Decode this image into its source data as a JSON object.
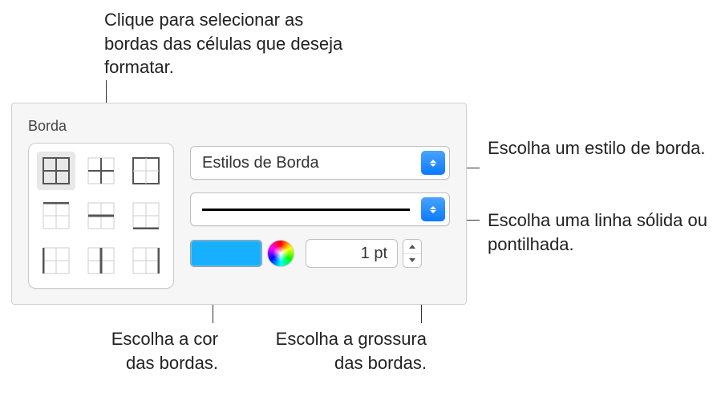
{
  "callouts": {
    "top": "Clique para selecionar as bordas das células que deseja formatar.",
    "right1": "Escolha um estilo de borda.",
    "right2": "Escolha uma linha sólida ou pontilhada.",
    "bottomLeft": "Escolha a cor das bordas.",
    "bottomRight": "Escolha a grossura das bordas."
  },
  "panel": {
    "title": "Borda",
    "borderButtons": [
      "all",
      "inside",
      "outside",
      "horizontal",
      "center-h",
      "vertical",
      "left",
      "center-v",
      "right"
    ],
    "styleDropdown": {
      "label": "Estilos de Borda"
    },
    "lineType": {
      "value": "solid"
    },
    "color": {
      "hex": "#19afff"
    },
    "thickness": {
      "value": "1 pt"
    }
  }
}
